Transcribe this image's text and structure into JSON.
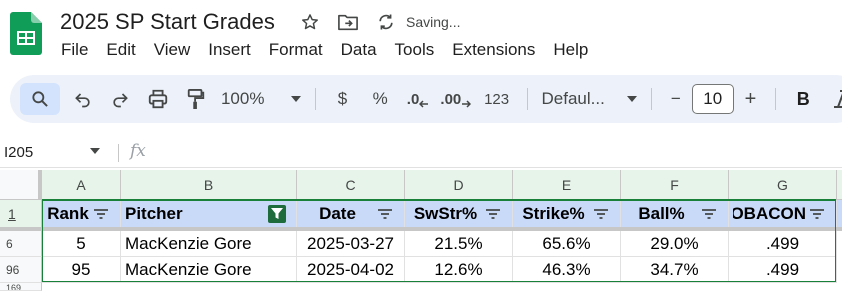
{
  "app": {
    "doc_title": "2025 SP Start Grades",
    "saving_status": "Saving...",
    "logo_icon": "google-sheets-logo",
    "brand_color": "#0f9d58"
  },
  "menu": [
    "File",
    "Edit",
    "View",
    "Insert",
    "Format",
    "Data",
    "Tools",
    "Extensions",
    "Help"
  ],
  "toolbar": {
    "zoom": "100%",
    "currency": "$",
    "percent": "%",
    "decrease_decimal": ".0",
    "increase_decimal": ".00",
    "more_formats": "123",
    "font": "Defaul...",
    "font_size": "10",
    "minus": "−",
    "plus": "+",
    "bold": "B"
  },
  "formula_bar": {
    "name_box": "I205",
    "fx": "fx"
  },
  "grid": {
    "column_letters": [
      "A",
      "B",
      "C",
      "D",
      "E",
      "F",
      "G"
    ],
    "header_row_number": "1",
    "headers": [
      "Rank",
      "Pitcher",
      "Date",
      "SwStr%",
      "Strike%",
      "Ball%",
      "xwOBACON"
    ],
    "active_filter_column": "Pitcher",
    "rows": [
      {
        "row_number": "6",
        "cells": [
          "5",
          "MacKenzie Gore",
          "2025-03-27",
          "21.5%",
          "65.6%",
          "29.0%",
          ".499"
        ]
      },
      {
        "row_number": "96",
        "cells": [
          "95",
          "MacKenzie Gore",
          "2025-04-02",
          "12.6%",
          "46.3%",
          "34.7%",
          ".499"
        ]
      }
    ],
    "partial_row_number": "169",
    "header_fill": "#c9daf8",
    "selection_color": "#188038"
  }
}
